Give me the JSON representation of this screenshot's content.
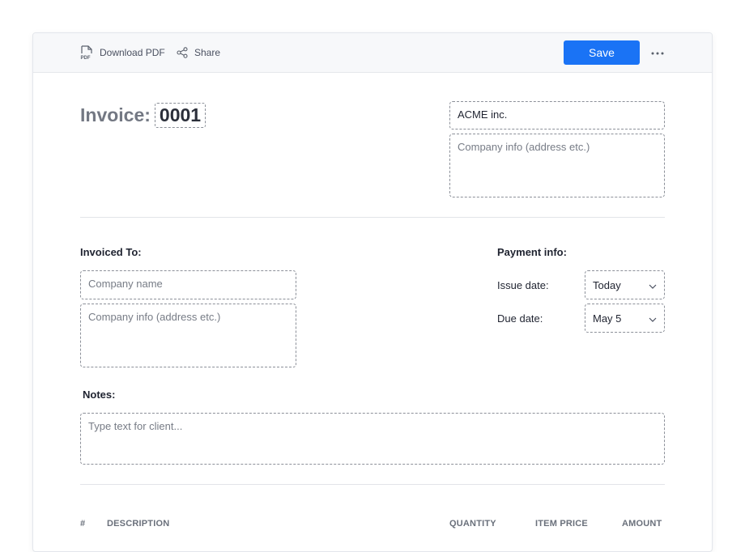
{
  "toolbar": {
    "download_label": "Download PDF",
    "download_icon": "pdf-file-icon",
    "share_label": "Share",
    "share_icon": "share-icon",
    "save_label": "Save",
    "more_icon": "more-dots-icon",
    "accent_color": "#1a73f5"
  },
  "invoice": {
    "title_label": "Invoice:",
    "number": "0001"
  },
  "sender": {
    "company_name": "ACME inc.",
    "company_info_placeholder": "Company info (address etc.)"
  },
  "invoiced_to": {
    "label": "Invoiced To:",
    "company_name_placeholder": "Company name",
    "company_info_placeholder": "Company info (address etc.)"
  },
  "payment": {
    "label": "Payment info:",
    "issue_date_label": "Issue date:",
    "issue_date_value": "Today",
    "due_date_label": "Due date:",
    "due_date_value": "May 5"
  },
  "notes": {
    "label": "Notes:",
    "placeholder": "Type text for client..."
  },
  "items_table": {
    "columns": [
      "#",
      "DESCRIPTION",
      "QUANTITY",
      "ITEM PRICE",
      "AMOUNT"
    ]
  }
}
